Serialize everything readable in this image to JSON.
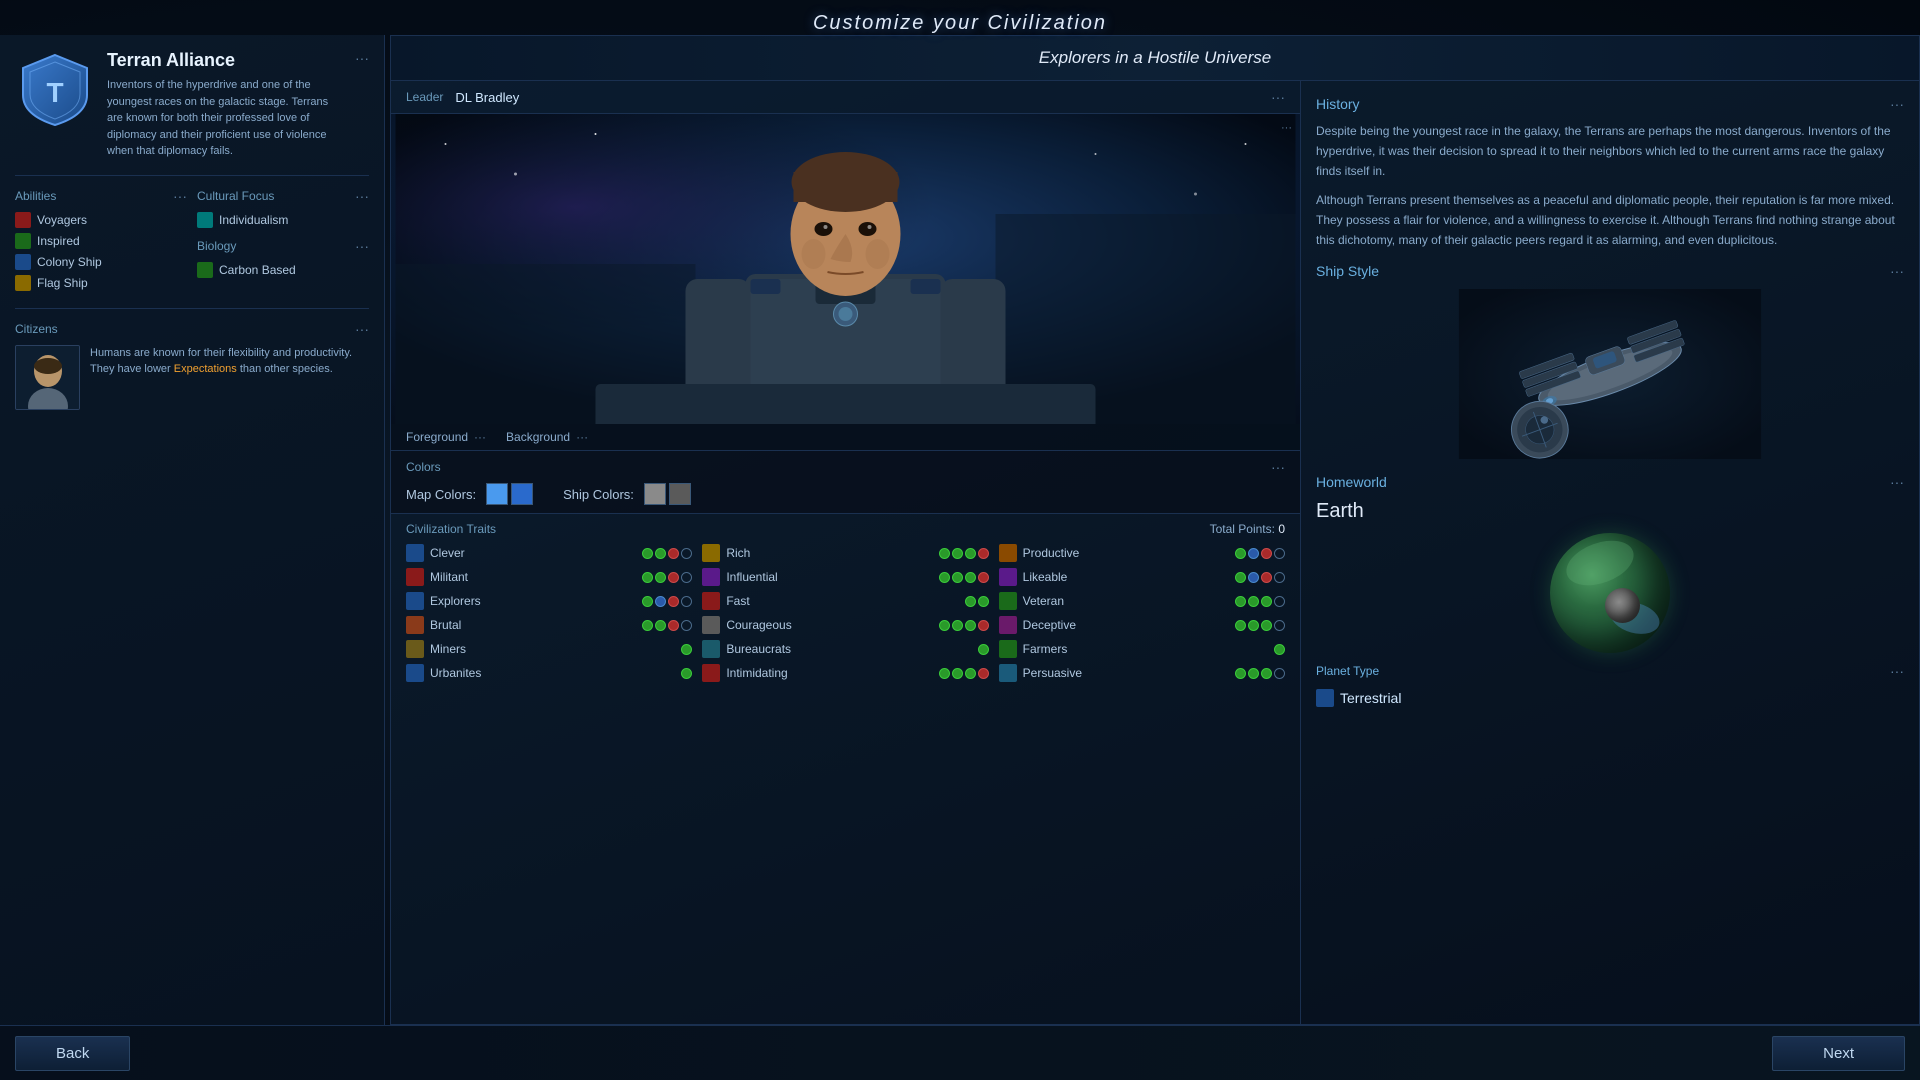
{
  "page": {
    "title": "Customize your Civilization"
  },
  "left_panel": {
    "civ_name": "Terran Alliance",
    "civ_desc": "Inventors of the hyperdrive and one of the youngest races on the galactic stage. Terrans are known for both their professed love of diplomacy and their proficient use of violence when that diplomacy fails.",
    "abilities_title": "Abilities",
    "abilities": [
      {
        "name": "Voyagers",
        "icon_color": "icon-red"
      },
      {
        "name": "Inspired",
        "icon_color": "icon-green"
      },
      {
        "name": "Colony Ship",
        "icon_color": "icon-blue"
      },
      {
        "name": "Flag Ship",
        "icon_color": "icon-yellow"
      }
    ],
    "cultural_focus_title": "Cultural Focus",
    "cultural_focus": [
      {
        "name": "Individualism",
        "icon_color": "icon-teal"
      }
    ],
    "biology_title": "Biology",
    "biology": [
      {
        "name": "Carbon Based",
        "icon_color": "icon-green"
      }
    ],
    "citizens_title": "Citizens",
    "citizen_desc": "Humans are known for their flexibility and productivity. They have lower",
    "citizen_highlight": "Expectations",
    "citizen_desc2": "than other species."
  },
  "main_panel": {
    "title": "Explorers in a Hostile Universe",
    "leader_label": "Leader",
    "leader_name": "DL Bradley",
    "history_title": "History",
    "history_p1": "Despite being the youngest race in the galaxy, the Terrans are perhaps the most dangerous. Inventors of the hyperdrive, it was their decision to spread it to their neighbors which led to the current arms race the galaxy finds itself in.",
    "history_p2": "Although Terrans present themselves as a peaceful and diplomatic people, their reputation is far more mixed. They possess a flair for violence, and a willingness to exercise it. Although Terrans find nothing strange about this dichotomy, many of their galactic peers regard it as alarming, and even duplicitous.",
    "ship_style_title": "Ship Style",
    "colors_title": "Colors",
    "foreground_label": "Foreground",
    "background_label": "Background",
    "map_colors_label": "Map Colors:",
    "ship_colors_label": "Ship Colors:",
    "traits_title": "Civilization Traits",
    "total_points_label": "Total Points:",
    "total_points_value": "0",
    "homeworld_title": "Homeworld",
    "homeworld_name": "Earth",
    "planet_type_title": "Planet Type",
    "planet_type": "Terrestrial",
    "traits": [
      {
        "name": "Clever",
        "dots": [
          "green",
          "green",
          "red",
          "empty"
        ],
        "col": 1
      },
      {
        "name": "Rich",
        "dots": [
          "green",
          "green",
          "green",
          "red"
        ],
        "col": 2
      },
      {
        "name": "Productive",
        "dots": [
          "green",
          "blue",
          "red",
          "empty"
        ],
        "col": 3
      },
      {
        "name": "Militant",
        "dots": [
          "green",
          "green",
          "red",
          "empty"
        ],
        "col": 1
      },
      {
        "name": "Influential",
        "dots": [
          "green",
          "green",
          "green",
          "red"
        ],
        "col": 2
      },
      {
        "name": "Likeable",
        "dots": [
          "green",
          "blue",
          "red",
          "empty"
        ],
        "col": 3
      },
      {
        "name": "Explorers",
        "dots": [
          "green",
          "blue",
          "red",
          "empty"
        ],
        "col": 1
      },
      {
        "name": "Fast",
        "dots": [
          "green",
          "green"
        ],
        "col": 2
      },
      {
        "name": "Veteran",
        "dots": [
          "green",
          "green",
          "green",
          "empty"
        ],
        "col": 3
      },
      {
        "name": "Brutal",
        "dots": [
          "green",
          "green",
          "red",
          "empty"
        ],
        "col": 1
      },
      {
        "name": "Courageous",
        "dots": [
          "green",
          "green",
          "green",
          "red"
        ],
        "col": 2
      },
      {
        "name": "Deceptive",
        "dots": [
          "green",
          "green",
          "green",
          "empty"
        ],
        "col": 3
      },
      {
        "name": "Miners",
        "dots": [
          "green"
        ],
        "col": 1
      },
      {
        "name": "Bureaucrats",
        "dots": [
          "green"
        ],
        "col": 2
      },
      {
        "name": "Farmers",
        "dots": [
          "green"
        ],
        "col": 3
      },
      {
        "name": "Urbanites",
        "dots": [
          "green"
        ],
        "col": 1
      },
      {
        "name": "Intimidating",
        "dots": [
          "green",
          "green",
          "green",
          "red"
        ],
        "col": 2
      },
      {
        "name": "Persuasive",
        "dots": [
          "green",
          "green",
          "green",
          "empty"
        ],
        "col": 3
      }
    ]
  },
  "buttons": {
    "back": "Back",
    "next": "Next"
  }
}
